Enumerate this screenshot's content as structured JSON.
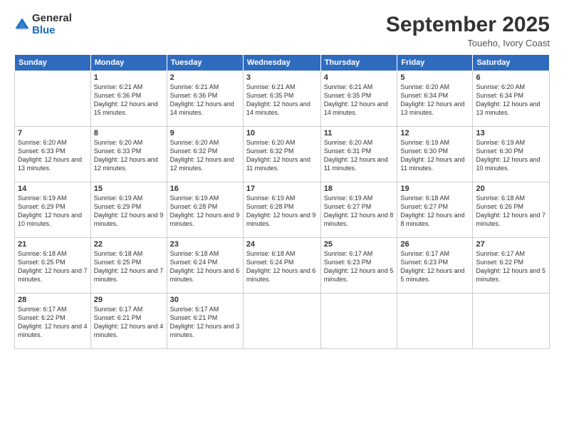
{
  "logo": {
    "general": "General",
    "blue": "Blue"
  },
  "title": "September 2025",
  "location": "Toueho, Ivory Coast",
  "days_header": [
    "Sunday",
    "Monday",
    "Tuesday",
    "Wednesday",
    "Thursday",
    "Friday",
    "Saturday"
  ],
  "weeks": [
    [
      {
        "day": "",
        "info": ""
      },
      {
        "day": "1",
        "info": "Sunrise: 6:21 AM\nSunset: 6:36 PM\nDaylight: 12 hours\nand 15 minutes."
      },
      {
        "day": "2",
        "info": "Sunrise: 6:21 AM\nSunset: 6:36 PM\nDaylight: 12 hours\nand 14 minutes."
      },
      {
        "day": "3",
        "info": "Sunrise: 6:21 AM\nSunset: 6:35 PM\nDaylight: 12 hours\nand 14 minutes."
      },
      {
        "day": "4",
        "info": "Sunrise: 6:21 AM\nSunset: 6:35 PM\nDaylight: 12 hours\nand 14 minutes."
      },
      {
        "day": "5",
        "info": "Sunrise: 6:20 AM\nSunset: 6:34 PM\nDaylight: 12 hours\nand 13 minutes."
      },
      {
        "day": "6",
        "info": "Sunrise: 6:20 AM\nSunset: 6:34 PM\nDaylight: 12 hours\nand 13 minutes."
      }
    ],
    [
      {
        "day": "7",
        "info": "Sunrise: 6:20 AM\nSunset: 6:33 PM\nDaylight: 12 hours\nand 13 minutes."
      },
      {
        "day": "8",
        "info": "Sunrise: 6:20 AM\nSunset: 6:33 PM\nDaylight: 12 hours\nand 12 minutes."
      },
      {
        "day": "9",
        "info": "Sunrise: 6:20 AM\nSunset: 6:32 PM\nDaylight: 12 hours\nand 12 minutes."
      },
      {
        "day": "10",
        "info": "Sunrise: 6:20 AM\nSunset: 6:32 PM\nDaylight: 12 hours\nand 11 minutes."
      },
      {
        "day": "11",
        "info": "Sunrise: 6:20 AM\nSunset: 6:31 PM\nDaylight: 12 hours\nand 11 minutes."
      },
      {
        "day": "12",
        "info": "Sunrise: 6:19 AM\nSunset: 6:30 PM\nDaylight: 12 hours\nand 11 minutes."
      },
      {
        "day": "13",
        "info": "Sunrise: 6:19 AM\nSunset: 6:30 PM\nDaylight: 12 hours\nand 10 minutes."
      }
    ],
    [
      {
        "day": "14",
        "info": "Sunrise: 6:19 AM\nSunset: 6:29 PM\nDaylight: 12 hours\nand 10 minutes."
      },
      {
        "day": "15",
        "info": "Sunrise: 6:19 AM\nSunset: 6:29 PM\nDaylight: 12 hours\nand 9 minutes."
      },
      {
        "day": "16",
        "info": "Sunrise: 6:19 AM\nSunset: 6:28 PM\nDaylight: 12 hours\nand 9 minutes."
      },
      {
        "day": "17",
        "info": "Sunrise: 6:19 AM\nSunset: 6:28 PM\nDaylight: 12 hours\nand 9 minutes."
      },
      {
        "day": "18",
        "info": "Sunrise: 6:19 AM\nSunset: 6:27 PM\nDaylight: 12 hours\nand 8 minutes."
      },
      {
        "day": "19",
        "info": "Sunrise: 6:18 AM\nSunset: 6:27 PM\nDaylight: 12 hours\nand 8 minutes."
      },
      {
        "day": "20",
        "info": "Sunrise: 6:18 AM\nSunset: 6:26 PM\nDaylight: 12 hours\nand 7 minutes."
      }
    ],
    [
      {
        "day": "21",
        "info": "Sunrise: 6:18 AM\nSunset: 6:25 PM\nDaylight: 12 hours\nand 7 minutes."
      },
      {
        "day": "22",
        "info": "Sunrise: 6:18 AM\nSunset: 6:25 PM\nDaylight: 12 hours\nand 7 minutes."
      },
      {
        "day": "23",
        "info": "Sunrise: 6:18 AM\nSunset: 6:24 PM\nDaylight: 12 hours\nand 6 minutes."
      },
      {
        "day": "24",
        "info": "Sunrise: 6:18 AM\nSunset: 6:24 PM\nDaylight: 12 hours\nand 6 minutes."
      },
      {
        "day": "25",
        "info": "Sunrise: 6:17 AM\nSunset: 6:23 PM\nDaylight: 12 hours\nand 5 minutes."
      },
      {
        "day": "26",
        "info": "Sunrise: 6:17 AM\nSunset: 6:23 PM\nDaylight: 12 hours\nand 5 minutes."
      },
      {
        "day": "27",
        "info": "Sunrise: 6:17 AM\nSunset: 6:22 PM\nDaylight: 12 hours\nand 5 minutes."
      }
    ],
    [
      {
        "day": "28",
        "info": "Sunrise: 6:17 AM\nSunset: 6:22 PM\nDaylight: 12 hours\nand 4 minutes."
      },
      {
        "day": "29",
        "info": "Sunrise: 6:17 AM\nSunset: 6:21 PM\nDaylight: 12 hours\nand 4 minutes."
      },
      {
        "day": "30",
        "info": "Sunrise: 6:17 AM\nSunset: 6:21 PM\nDaylight: 12 hours\nand 3 minutes."
      },
      {
        "day": "",
        "info": ""
      },
      {
        "day": "",
        "info": ""
      },
      {
        "day": "",
        "info": ""
      },
      {
        "day": "",
        "info": ""
      }
    ]
  ]
}
